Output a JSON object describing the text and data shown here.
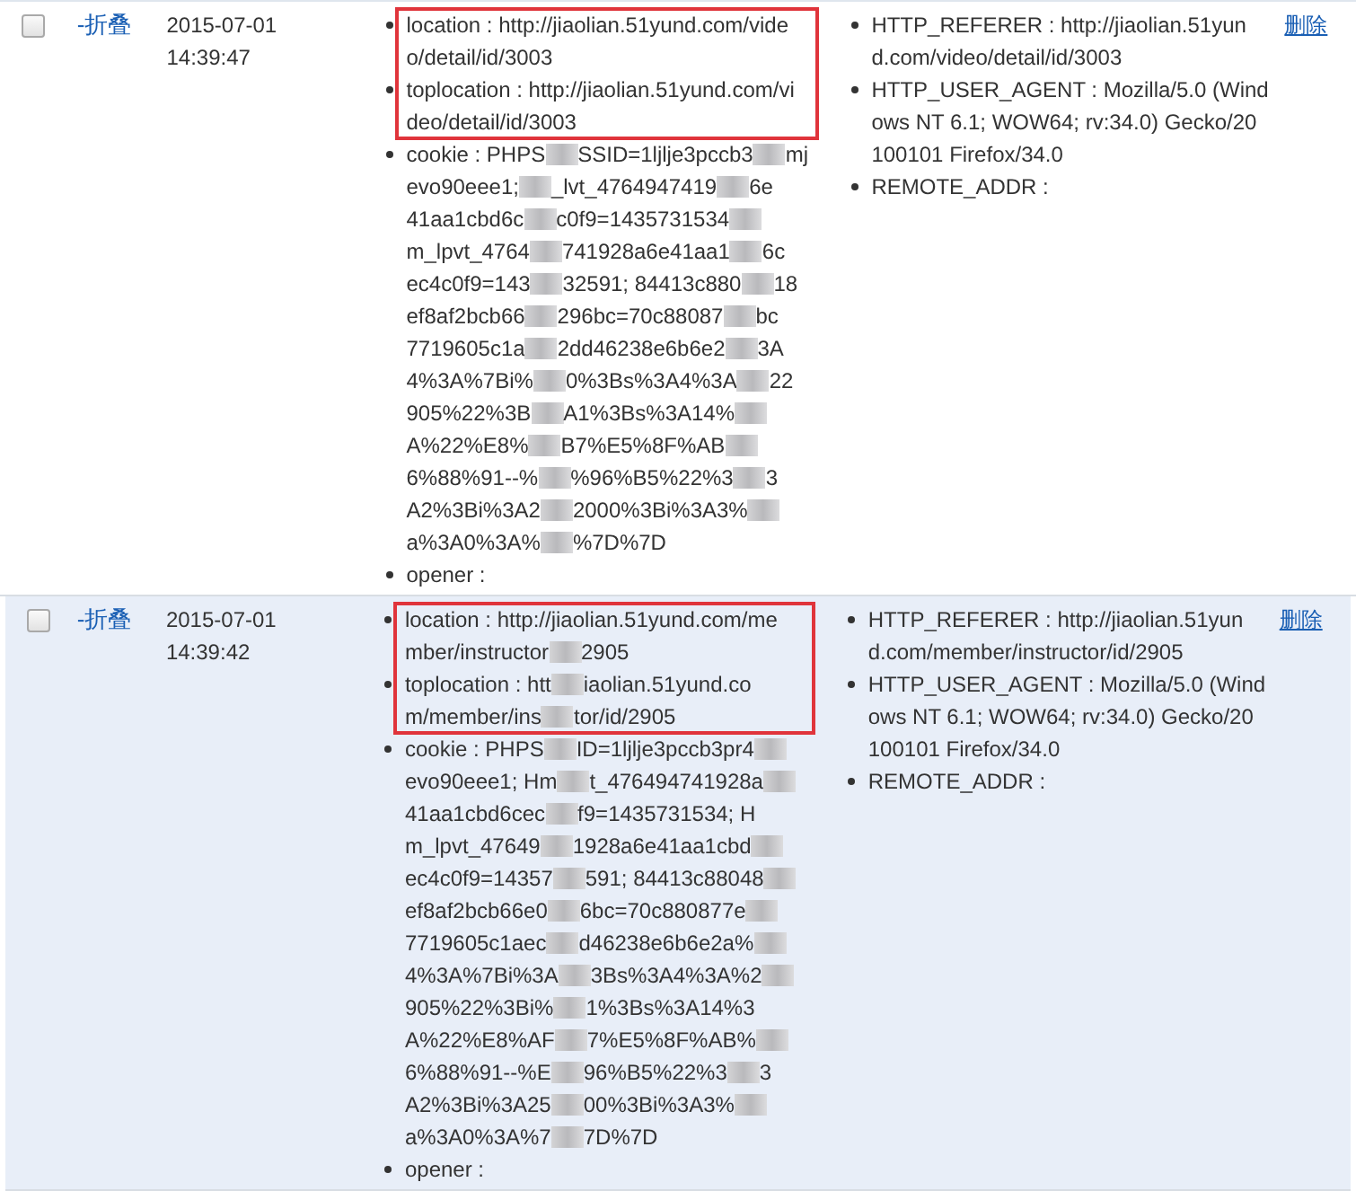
{
  "rows": [
    {
      "checked": false,
      "hovered": false,
      "toggle": "-折叠",
      "time": "2015-07-01 14:39:47",
      "delete": "删除",
      "details": [
        {
          "highlighted": true,
          "lines": [
            [
              "location : http://jiaolian.51yund.com/vide"
            ],
            [
              "o/detail/id/3003"
            ]
          ]
        },
        {
          "highlighted": true,
          "lines": [
            [
              "toplocation : http://jiaolian.51yund.com/vi"
            ],
            [
              "deo/detail/id/3003"
            ]
          ]
        },
        {
          "highlighted": false,
          "lines": [
            [
              "cookie : PHPS",
              {
                "kind": "blur"
              },
              "SSID=1ljlje3pccb3",
              {
                "kind": "blur"
              },
              "mj"
            ],
            [
              "evo90eee1; ",
              {
                "kind": "blur"
              },
              "_lvt_4764947419",
              {
                "kind": "blur"
              },
              "6e"
            ],
            [
              "41aa1cbd6c",
              {
                "kind": "blur"
              },
              "c0f9=1435731534",
              {
                "kind": "blur"
              }
            ],
            [
              "m_lpvt_4764",
              {
                "kind": "blur"
              },
              "741928a6e41aa1",
              {
                "kind": "blur"
              },
              "6c"
            ],
            [
              "ec4c0f9=143",
              {
                "kind": "blur"
              },
              "32591; 84413c880",
              {
                "kind": "blur"
              },
              "18"
            ],
            [
              "ef8af2bcb66",
              {
                "kind": "blur"
              },
              "296bc=70c88087",
              {
                "kind": "blur"
              },
              "bc"
            ],
            [
              "7719605c1a",
              {
                "kind": "blur"
              },
              "2dd46238e6b6e2",
              {
                "kind": "blur"
              },
              "3A"
            ],
            [
              "4%3A%7Bi%",
              {
                "kind": "blur"
              },
              "0%3Bs%3A4%3A",
              {
                "kind": "blur"
              },
              "22"
            ],
            [
              "905%22%3B",
              {
                "kind": "blur"
              },
              "A1%3Bs%3A14%",
              {
                "kind": "blur"
              }
            ],
            [
              "A%22%E8%",
              {
                "kind": "blur"
              },
              "B7%E5%8F%AB",
              {
                "kind": "blur"
              }
            ],
            [
              "6%88%91--%",
              {
                "kind": "blur"
              },
              "%96%B5%22%3",
              {
                "kind": "blur"
              },
              "3"
            ],
            [
              "A2%3Bi%3A2",
              {
                "kind": "blur"
              },
              "2000%3Bi%3A3%",
              {
                "kind": "blur"
              }
            ],
            [
              "a%3A0%3A%",
              {
                "kind": "blur"
              },
              "%7D%7D"
            ]
          ]
        },
        {
          "highlighted": false,
          "lines": [
            [
              "opener :"
            ]
          ]
        }
      ],
      "headers": [
        {
          "lines": [
            [
              "HTTP_REFERER : http://jiaolian.51yun"
            ],
            [
              "d.com/video/detail/id/3003"
            ]
          ]
        },
        {
          "lines": [
            [
              "HTTP_USER_AGENT : Mozilla/5.0 (Wind"
            ],
            [
              "ows NT 6.1; WOW64; rv:34.0) Gecko/20"
            ],
            [
              "100101 Firefox/34.0"
            ]
          ]
        },
        {
          "lines": [
            [
              "REMOTE_ADDR :"
            ]
          ]
        }
      ]
    },
    {
      "checked": false,
      "hovered": true,
      "toggle": "-折叠",
      "time": "2015-07-01 14:39:42",
      "delete": "删除",
      "details": [
        {
          "highlighted": true,
          "lines": [
            [
              "location : http://jiaolian.51yund.com/me"
            ],
            [
              "mber/instructor",
              {
                "kind": "blur"
              },
              "2905"
            ]
          ]
        },
        {
          "highlighted": true,
          "lines": [
            [
              "toplocation : htt",
              {
                "kind": "blur"
              },
              "iaolian.51yund.co"
            ],
            [
              "m/member/ins",
              {
                "kind": "blur"
              },
              "tor/id/2905"
            ]
          ]
        },
        {
          "highlighted": false,
          "lines": [
            [
              "cookie : PHPS",
              {
                "kind": "blur"
              },
              "ID=1ljlje3pccb3pr4",
              {
                "kind": "blur"
              }
            ],
            [
              "evo90eee1; Hm",
              {
                "kind": "blur"
              },
              "t_476494741928a",
              {
                "kind": "blur"
              }
            ],
            [
              "41aa1cbd6cec",
              {
                "kind": "blur"
              },
              "f9=1435731534; H"
            ],
            [
              "m_lpvt_47649",
              {
                "kind": "blur"
              },
              "1928a6e41aa1cbd",
              {
                "kind": "blur"
              }
            ],
            [
              "ec4c0f9=14357",
              {
                "kind": "blur"
              },
              "591; 84413c88048",
              {
                "kind": "blur"
              }
            ],
            [
              "ef8af2bcb66e0",
              {
                "kind": "blur"
              },
              "6bc=70c880877e",
              {
                "kind": "blur"
              }
            ],
            [
              "7719605c1aec",
              {
                "kind": "blur"
              },
              "d46238e6b6e2a%",
              {
                "kind": "blur"
              }
            ],
            [
              "4%3A%7Bi%3A",
              {
                "kind": "blur"
              },
              "3Bs%3A4%3A%2",
              {
                "kind": "blur"
              }
            ],
            [
              "905%22%3Bi%",
              {
                "kind": "blur"
              },
              "1%3Bs%3A14%3"
            ],
            [
              "A%22%E8%AF",
              {
                "kind": "blur"
              },
              "7%E5%8F%AB%",
              {
                "kind": "blur"
              }
            ],
            [
              "6%88%91--%E",
              {
                "kind": "blur"
              },
              "96%B5%22%3",
              {
                "kind": "blur"
              },
              "3"
            ],
            [
              "A2%3Bi%3A25",
              {
                "kind": "blur"
              },
              "00%3Bi%3A3%",
              {
                "kind": "blur"
              }
            ],
            [
              "a%3A0%3A%7",
              {
                "kind": "blur"
              },
              "7D%7D"
            ]
          ]
        },
        {
          "highlighted": false,
          "lines": [
            [
              "opener :"
            ]
          ]
        }
      ],
      "headers": [
        {
          "lines": [
            [
              "HTTP_REFERER : http://jiaolian.51yun"
            ],
            [
              "d.com/member/instructor/id/2905"
            ]
          ]
        },
        {
          "lines": [
            [
              "HTTP_USER_AGENT : Mozilla/5.0 (Wind"
            ],
            [
              "ows NT 6.1; WOW64; rv:34.0) Gecko/20"
            ],
            [
              "100101 Firefox/34.0"
            ]
          ]
        },
        {
          "lines": [
            [
              "REMOTE_ADDR :"
            ]
          ]
        }
      ]
    }
  ]
}
